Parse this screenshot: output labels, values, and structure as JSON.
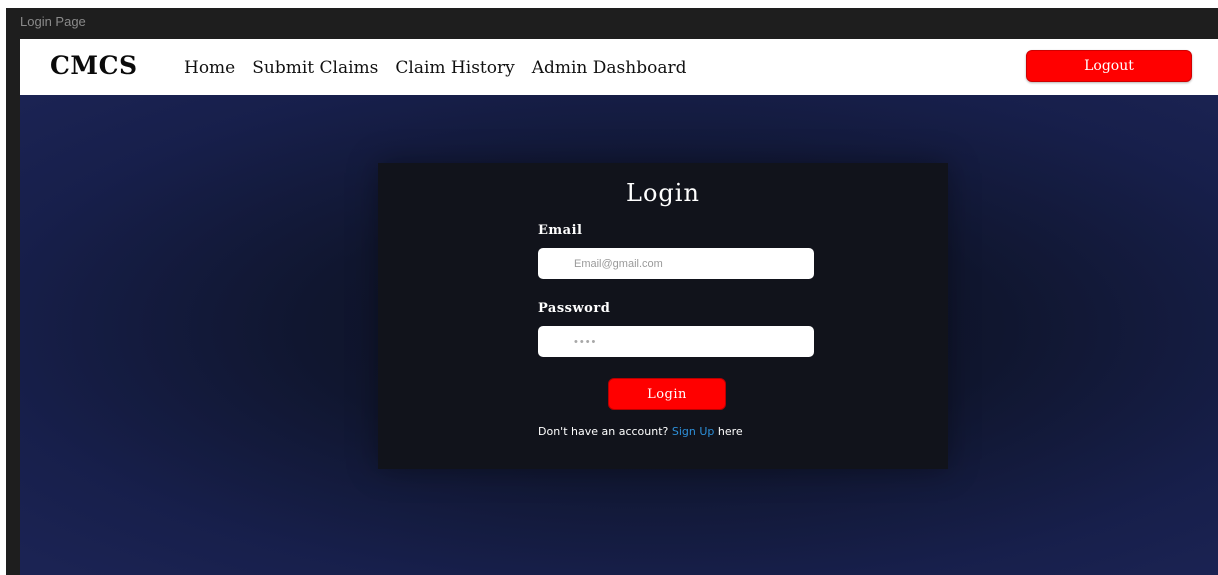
{
  "window": {
    "title": "Login Page"
  },
  "navbar": {
    "brand": "CMCS",
    "links": [
      {
        "label": "Home"
      },
      {
        "label": "Submit Claims"
      },
      {
        "label": "Claim History"
      },
      {
        "label": "Admin Dashboard"
      }
    ],
    "logout_label": "Logout"
  },
  "login_form": {
    "title": "Login",
    "email_label": "Email",
    "email_value": "",
    "email_placeholder": "Email@gmail.com",
    "password_label": "Password",
    "password_value": "",
    "password_placeholder": "••••",
    "submit_label": "Login",
    "signup_prefix": "Don't have an account?",
    "signup_link": "Sign Up",
    "signup_suffix": "here"
  },
  "colors": {
    "accent": "#ff0000",
    "link": "#2d8fd8",
    "card_bg": "#11131b",
    "page_bg": "#1b2353"
  }
}
